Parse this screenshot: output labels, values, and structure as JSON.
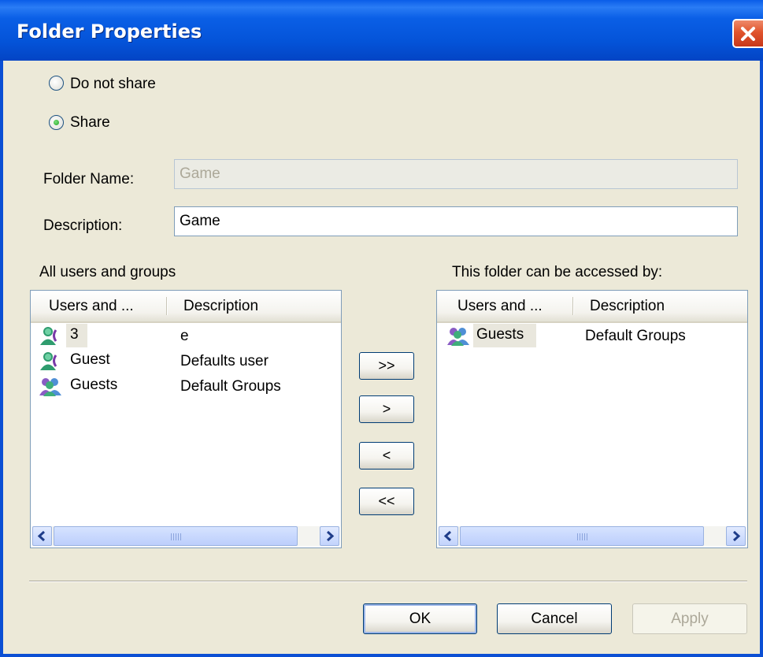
{
  "window": {
    "title": "Folder Properties",
    "close_icon": "close-icon",
    "accent_color": "#0453d8",
    "close_color": "#e0542d"
  },
  "sharing": {
    "do_not_share_label": "Do not share",
    "share_label": "Share",
    "selected": "Share"
  },
  "form": {
    "folder_name_label": "Folder Name:",
    "folder_name_value": "Game",
    "description_label": "Description:",
    "description_value": "Game"
  },
  "all_users": {
    "heading": "All users and groups",
    "columns": [
      "Users and ...",
      "Description"
    ],
    "rows": [
      {
        "name": "3",
        "description": "e",
        "icon": "user-icon"
      },
      {
        "name": "Guest",
        "description": "Defaults user",
        "icon": "user-icon"
      },
      {
        "name": "Guests",
        "description": "Default Groups",
        "icon": "group-icon"
      }
    ],
    "scroll_left_icon": "arrow-left-icon",
    "scroll_right_icon": "arrow-right-icon"
  },
  "accessed_by": {
    "heading": "This folder can be accessed by:",
    "columns": [
      "Users and ...",
      "Description"
    ],
    "rows": [
      {
        "name": "Guests",
        "description": "Default Groups",
        "icon": "group-icon"
      }
    ],
    "scroll_left_icon": "arrow-left-icon",
    "scroll_right_icon": "arrow-right-icon"
  },
  "move_buttons": {
    "add_all": ">>",
    "add": ">",
    "remove": "<",
    "remove_all": "<<"
  },
  "footer": {
    "ok": "OK",
    "cancel": "Cancel",
    "apply": "Apply"
  }
}
